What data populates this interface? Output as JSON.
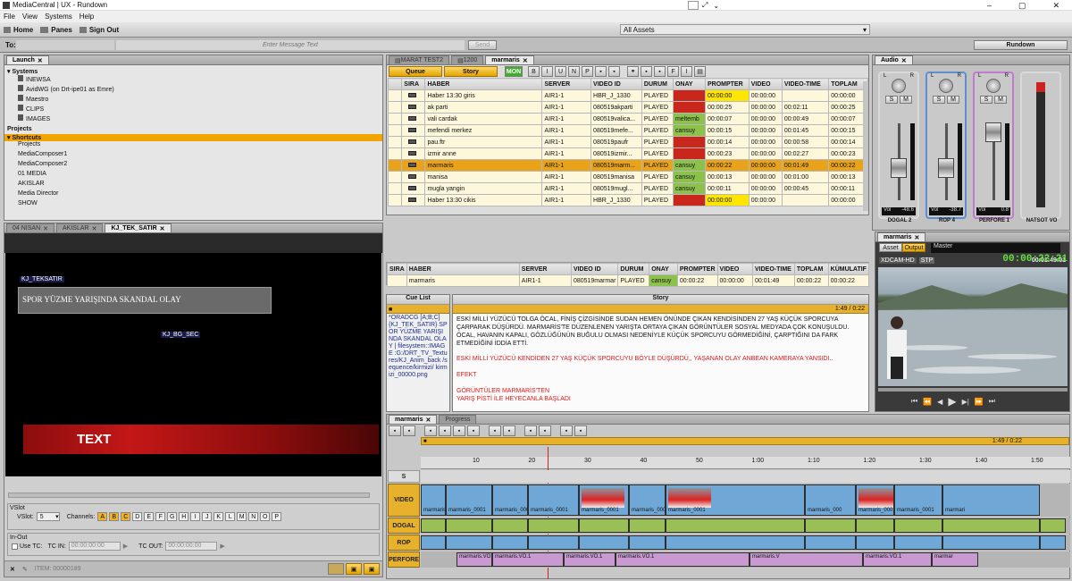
{
  "window": {
    "title": "MediaCentral | UX - Rundown"
  },
  "menu": [
    "File",
    "View",
    "Systems",
    "Help"
  ],
  "toolbar": {
    "home": "Home",
    "panes": "Panes",
    "signout": "Sign Out",
    "assets_select": "All Assets"
  },
  "message": {
    "to_label": "To:",
    "placeholder": "Enter Message Text",
    "send": "Send",
    "rundown_button": "Rundown"
  },
  "launch": {
    "tab": "Launch",
    "systems_label": "Systems",
    "systems": [
      "INEWSA",
      "AvidWG (on Drt-ipe01 as Emre)",
      "Maestro",
      "CLIPS",
      "IMAGES"
    ],
    "projects_label": "Projects",
    "shortcuts_label": "Shortcuts",
    "shortcuts": [
      "Projects",
      "MediaComposer1",
      "MediaComposer2",
      "01 MEDIA",
      "AKISLAR",
      "Media Director",
      "SHOW"
    ]
  },
  "maestro": {
    "tabs": [
      "04 NISAN",
      "AKISLAR",
      "KJ_TEK_SATIR"
    ],
    "label1": "KJ_TEKSATIR",
    "headline": "SPOR YÜZME YARIŞINDA SKANDAL OLAY",
    "label2": "KJ_BG_SEC",
    "text_bar": "TEXT",
    "vslot_title": "VSlot",
    "vslot_label": "VSlot:",
    "vslot_value": "5",
    "channels_label": "Channels:",
    "channels": [
      "A",
      "B",
      "C",
      "D",
      "E",
      "F",
      "G",
      "H",
      "I",
      "J",
      "K",
      "L",
      "M",
      "N",
      "O",
      "P"
    ],
    "inout_title": "In-Out",
    "use_tc": "Use TC:",
    "tc_in": "TC IN:",
    "tc_in_value": "00:00:00:00",
    "tc_out": "TC OUT:",
    "tc_out_value": "00:00:00:00",
    "item": "ITEM: 00000189"
  },
  "rundown": {
    "tabs": [
      "MARAT TEST2",
      "1200",
      "marmaris"
    ],
    "queue": "Queue",
    "story": "Story",
    "mon": "MON",
    "columns": [
      "SIRA",
      "HABER",
      "SERVER",
      "VIDEO ID",
      "DURUM",
      "ONAY",
      "PROMPTER",
      "VIDEO",
      "VIDEO-TIME",
      "TOPLAM"
    ],
    "rows": [
      {
        "haber": "Haber 13:30 giris",
        "server": "AIR1-1",
        "vid": "HBR_J_1330",
        "durum": "PLAYED",
        "onay": "",
        "onay_c": "red",
        "prompter": "00:00:00",
        "p_c": "yel",
        "video": "00:00:00",
        "vtime": "",
        "toplam": "00:00:00"
      },
      {
        "haber": "ak parti",
        "server": "AIR1-1",
        "vid": "080519akparti",
        "durum": "PLAYED",
        "onay": "",
        "onay_c": "red",
        "prompter": "00:00:25",
        "p_c": "",
        "video": "00:00:00",
        "vtime": "00:02:11",
        "toplam": "00:00:25"
      },
      {
        "haber": "vali cardak",
        "server": "AIR1-1",
        "vid": "080519valica...",
        "durum": "PLAYED",
        "onay": "meltemb",
        "onay_c": "grn",
        "prompter": "00:00:07",
        "p_c": "",
        "video": "00:00:00",
        "vtime": "00:00:49",
        "toplam": "00:00:07"
      },
      {
        "haber": "mefendi merkez",
        "server": "AIR1-1",
        "vid": "080519mefe...",
        "durum": "PLAYED",
        "onay": "cansuy",
        "onay_c": "grn",
        "prompter": "00:00:15",
        "p_c": "",
        "video": "00:00:00",
        "vtime": "00:01:45",
        "toplam": "00:00:15"
      },
      {
        "haber": "pau.ftr",
        "server": "AIR1-1",
        "vid": "080519paufr",
        "durum": "PLAYED",
        "onay": "",
        "onay_c": "red",
        "prompter": "00:00:14",
        "p_c": "",
        "video": "00:00:00",
        "vtime": "00:00:58",
        "toplam": "00:00:14"
      },
      {
        "haber": "izmir anne",
        "server": "AIR1-1",
        "vid": "080519izmir...",
        "durum": "PLAYED",
        "onay": "",
        "onay_c": "red",
        "prompter": "00:00:23",
        "p_c": "",
        "video": "00:00:00",
        "vtime": "00:02:27",
        "toplam": "00:00:23"
      },
      {
        "haber": "marmaris",
        "server": "AIR1-1",
        "vid": "080519marm...",
        "durum": "PLAYED",
        "onay": "cansuy",
        "onay_c": "grn",
        "prompter": "00:00:22",
        "p_c": "",
        "video": "00:00:00",
        "vtime": "00:01:49",
        "toplam": "00:00:22",
        "selected": true
      },
      {
        "haber": "manisa",
        "server": "AIR1-1",
        "vid": "080519manisa",
        "durum": "PLAYED",
        "onay": "cansuy",
        "onay_c": "grn",
        "prompter": "00:00:13",
        "p_c": "",
        "video": "00:00:00",
        "vtime": "00:01:00",
        "toplam": "00:00:13"
      },
      {
        "haber": "mugla yangin",
        "server": "AIR1-1",
        "vid": "080519mugl...",
        "durum": "PLAYED",
        "onay": "cansuy",
        "onay_c": "grn",
        "prompter": "00:00:11",
        "p_c": "",
        "video": "00:00:00",
        "vtime": "00:00:45",
        "toplam": "00:00:11"
      },
      {
        "haber": "Haber 13:30 cikis",
        "server": "AIR1-1",
        "vid": "HBR_J_1330",
        "durum": "PLAYED",
        "onay": "",
        "onay_c": "red",
        "prompter": "00:00:00",
        "p_c": "yel",
        "video": "00:00:00",
        "vtime": "",
        "toplam": "00:00:00"
      }
    ],
    "editor_columns": [
      "SIRA",
      "HABER",
      "SERVER",
      "VIDEO ID",
      "DURUM",
      "ONAY",
      "PROMPTER",
      "VIDEO",
      "VIDEO-TIME",
      "TOPLAM",
      "KÜMULATIF"
    ],
    "editor_row": {
      "haber": "marmaris",
      "server": "AIR1-1",
      "vid": "080519marmar",
      "durum": "PLAYED",
      "onay": "cansuy",
      "prompter": "00:00:22",
      "video": "00:00:00",
      "vtime": "00:01:49",
      "toplam": "00:00:22",
      "kum": "00:00:22"
    }
  },
  "cue": {
    "title": "Cue List",
    "text": "*ORADCG [A;B;C] {KJ_TEK_SATIR} SPOR YÜZME YARIŞINDA SKANDAL OLAY | filesystem::IMAGE :G:/DRT_TV_Textu res/KJ_Anim_back /sequence/kirmizi/ kirmizi_00000.png"
  },
  "story": {
    "title": "Story",
    "duration": "1:49 / 0:22",
    "p1": "ESKİ MİLLİ YÜZÜCÜ TOLGA ÖCAL, FİNİŞ ÇİZGİSİNDE SUDAN HEMEN ÖNÜNDE ÇIKAN KENDİSİNDEN 27 YAŞ KÜÇÜK SPORCUYA ÇARPARAK DÜŞÜRDÜ. MARMARİS'TE DÜZENLENEN YARIŞTA ORTAYA ÇIKAN GÖRÜNTÜLER SOSYAL MEDYADA ÇOK KONUŞULDU. ÖCAL, HAVANIN KAPALI, GÖZLÜĞÜNÜN BUĞULU OLMASI NEDENİYLE KÜÇÜK SPORCUYU GÖRMEDİĞİNİ, ÇARPTIĞINI DA FARK ETMEDİĞİNİ İDDİA ETTİ.",
    "p2": "ESKİ MİLLİ YÜZÜCÜ KENDİDEN 27 YAŞ KÜÇÜK SPORCUYU BÖYLE DÜŞÜRDÜ,, YAŞANAN OLAY ANBEAN KAMERAYA YANSIDI..",
    "p3": "EFEKT",
    "p4": "GÖRÜNTÜLER MARMARİS'TEN",
    "p5": "YARIŞ PİSTİ İLE HEYECANLA BAŞLADI"
  },
  "timeline": {
    "tabs": [
      "marmaris",
      "Progress"
    ],
    "duration": "1:49 / 0:22",
    "ruler": [
      "10",
      "20",
      "30",
      "40",
      "50",
      "1:00",
      "1:10",
      "1:20",
      "1:30",
      "1:40",
      "1:50"
    ],
    "tracks": [
      "S",
      "VIDEO",
      "DOGAL",
      "ROP",
      "PERFORE"
    ],
    "video_clips": [
      "marmaris_0001",
      "marmaris_0001",
      "marmaris_0001",
      "marmaris_0001",
      "marmaris_0001",
      "marmaris_0001",
      "marmaris_0001",
      "marmaris_000",
      "marmaris_0001",
      "marmaris_0001",
      "marmari"
    ],
    "vo_clips": [
      "marmaris.VO.1",
      "marmaris.VO.1",
      "marmaris.VO.1",
      "marmaris.VO.1",
      "marmaris.V",
      "marmaris.VO.1",
      "marmar"
    ]
  },
  "audio": {
    "tab": "Audio",
    "channels": [
      {
        "name": "DOGAL 2",
        "vol": "-48.6",
        "color": "#d9d9d9"
      },
      {
        "name": "ROP 4",
        "vol": "-38.7",
        "color": "#5d8fd0"
      },
      {
        "name": "PERFORE 1",
        "vol": "0.8",
        "color": "#c27ad1"
      },
      {
        "name": "NATSOT VO",
        "vol": "",
        "color": "#d9d9d9"
      }
    ],
    "vol_label": "Vol",
    "lr": [
      "L",
      "R"
    ]
  },
  "player": {
    "tab": "marmaris",
    "asset": "Asset",
    "output": "Output",
    "master": "Master",
    "timecode": "00:00:22:21",
    "format": "XDCAM-HD",
    "stp": "STP",
    "duration": "00:01:49:01"
  }
}
